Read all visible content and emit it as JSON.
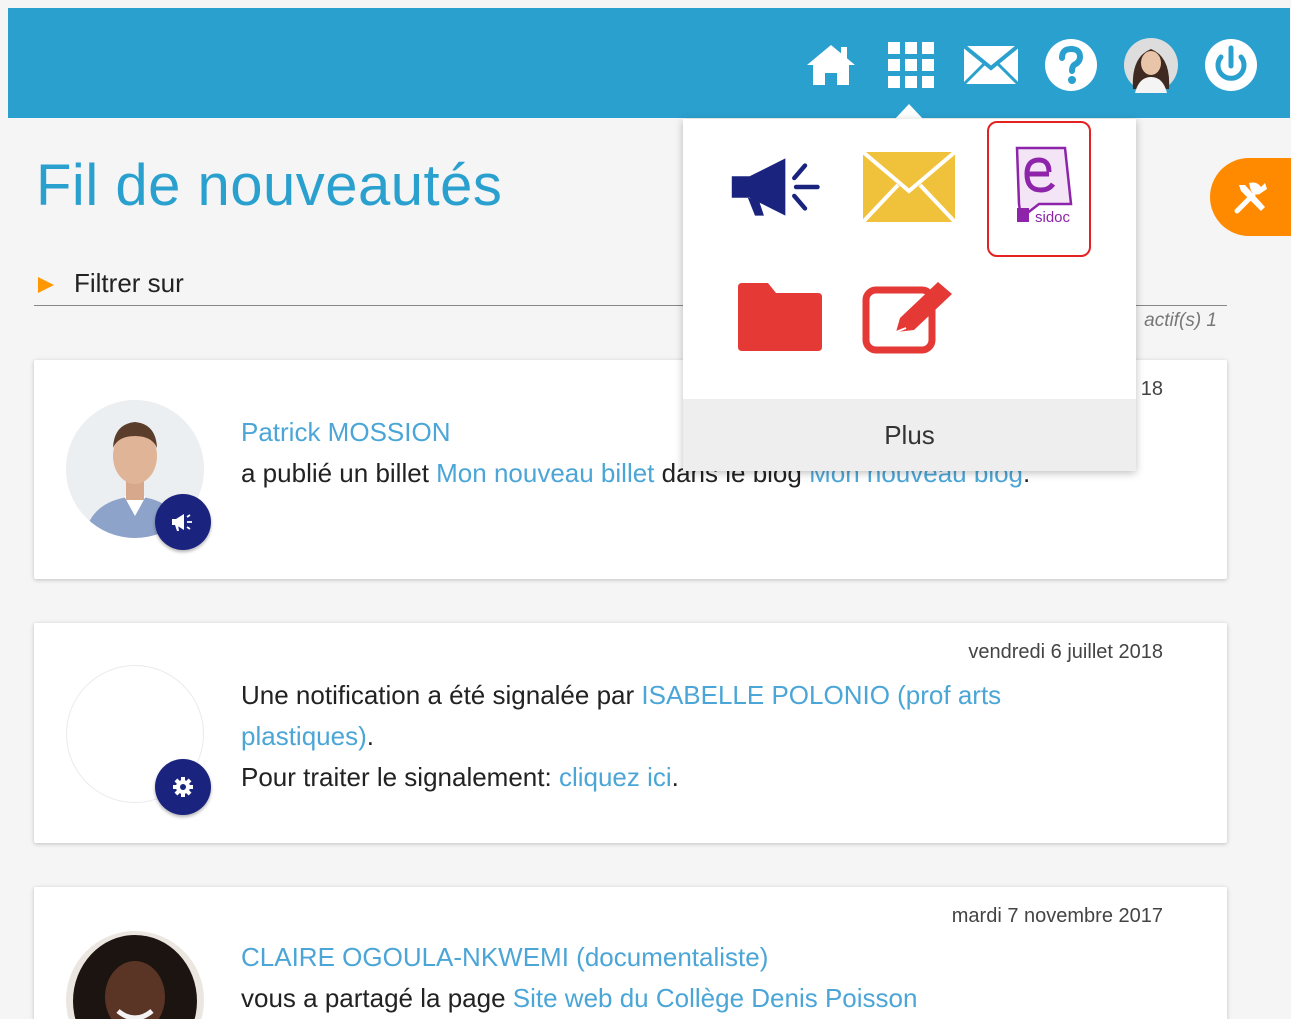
{
  "header": {
    "nav": [
      {
        "icon": "home-icon"
      },
      {
        "icon": "apps-grid-icon"
      },
      {
        "icon": "mail-icon"
      },
      {
        "icon": "help-icon"
      },
      {
        "icon": "user-avatar"
      },
      {
        "icon": "power-icon"
      }
    ],
    "color": "#2aa0cf"
  },
  "page": {
    "title": "Fil de nouveautés",
    "filter_label": "Filtrer sur",
    "active_count_text": "actif(s) 1"
  },
  "apps_menu": {
    "apps": [
      {
        "name": "megaphone-icon",
        "color": "#1a237e"
      },
      {
        "name": "envelope-icon",
        "color": "#f0c13a"
      },
      {
        "name": "esidoc-icon",
        "label": "sidoc",
        "color": "#8e24aa",
        "highlighted": true
      },
      {
        "name": "folder-icon",
        "color": "#e53935"
      },
      {
        "name": "edit-icon",
        "color": "#e53935"
      }
    ],
    "more_label": "Plus"
  },
  "feed": {
    "items": [
      {
        "date": "18",
        "author": "Patrick MOSSION",
        "text_1": "a publié un billet ",
        "link_1": "Mon nouveau billet",
        "text_2": " dans le blog ",
        "link_2": "Mon nouveau blog",
        "text_3": ".",
        "badge_icon": "megaphone-icon"
      },
      {
        "date": "vendredi 6 juillet 2018",
        "text_1": "Une notification a été signalée par ",
        "link_1": "ISABELLE POLONIO (prof arts plastiques)",
        "text_2": ".",
        "text_3": "Pour traiter le signalement: ",
        "link_2": "cliquez ici",
        "text_4": ".",
        "badge_icon": "gear-icon"
      },
      {
        "date": "mardi 7 novembre 2017",
        "author": "CLAIRE OGOULA-NKWEMI (documentaliste)",
        "text_1": "vous a partagé la page ",
        "link_1": "Site web du Collège Denis Poisson"
      }
    ]
  },
  "colors": {
    "accent": "#2aa0cf",
    "orange": "#ff8a00",
    "badge": "#1a237e",
    "link": "#4ba6d7"
  }
}
